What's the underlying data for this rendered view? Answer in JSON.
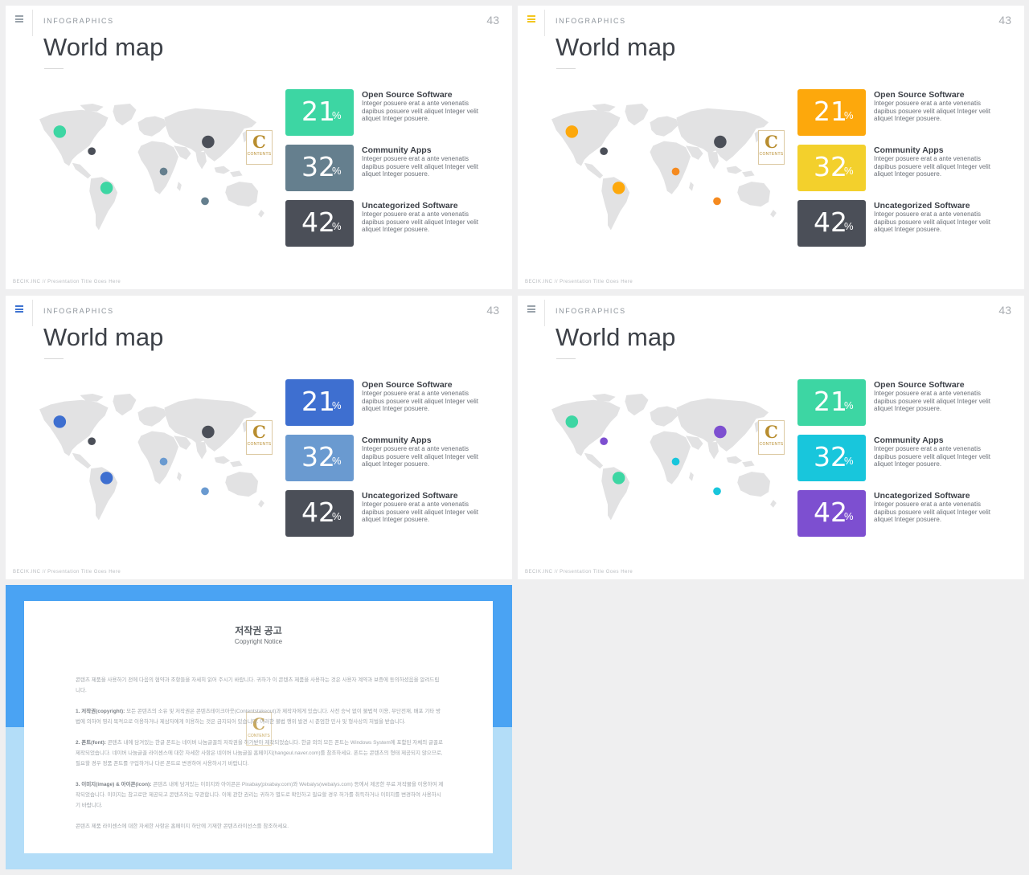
{
  "slides": [
    {
      "tag": "INFOGRAPHICS",
      "title": "World map",
      "page": "43",
      "footer": "BECIK.INC  //  Presentation  Title  Goes  Here",
      "logo": {
        "letter": "C",
        "text": "CONTENTS"
      },
      "accent": "#9aa3ab",
      "dot_colors": [
        "#3dd6a3",
        "#4b4f58",
        "#3dd6a3",
        "#657f8e",
        "#4b4f58",
        "#657f8e"
      ],
      "stats": [
        {
          "value": "21",
          "unit": "%",
          "label": "Open Source Software",
          "desc": "Integer posuere erat a ante venenatis dapibus posuere velit aliquet Integer velit aliquet Integer posuere.",
          "color": "#3dd6a3"
        },
        {
          "value": "32",
          "unit": "%",
          "label": "Community Apps",
          "desc": "Integer posuere erat a ante venenatis dapibus posuere velit aliquet Integer velit aliquet Integer posuere.",
          "color": "#657f8e"
        },
        {
          "value": "42",
          "unit": "%",
          "label": "Uncategorized Software",
          "desc": "Integer posuere erat a ante venenatis dapibus posuere velit aliquet Integer velit aliquet Integer posuere.",
          "color": "#4b4f58"
        }
      ]
    },
    {
      "tag": "INFOGRAPHICS",
      "title": "World map",
      "page": "43",
      "footer": "BECIK.INC  //  Presentation  Title  Goes  Here",
      "logo": {
        "letter": "C",
        "text": "CONTENTS"
      },
      "accent": "#f3c61f",
      "dot_colors": [
        "#fda80c",
        "#4b4f58",
        "#fda80c",
        "#f58a1f",
        "#4b4f58",
        "#f58a1f"
      ],
      "stats": [
        {
          "value": "21",
          "unit": "%",
          "label": "Open Source Software",
          "desc": "Integer posuere erat a ante venenatis dapibus posuere velit aliquet Integer velit aliquet Integer posuere.",
          "color": "#fda80c"
        },
        {
          "value": "32",
          "unit": "%",
          "label": "Community Apps",
          "desc": "Integer posuere erat a ante venenatis dapibus posuere velit aliquet Integer velit aliquet Integer posuere.",
          "color": "#f3d02c"
        },
        {
          "value": "42",
          "unit": "%",
          "label": "Uncategorized Software",
          "desc": "Integer posuere erat a ante venenatis dapibus posuere velit aliquet Integer velit aliquet Integer posuere.",
          "color": "#4b4f58"
        }
      ]
    },
    {
      "tag": "INFOGRAPHICS",
      "title": "World map",
      "page": "43",
      "footer": "BECIK.INC  //  Presentation  Title  Goes  Here",
      "logo": {
        "letter": "C",
        "text": "CONTENTS"
      },
      "accent": "#3e73d1",
      "dot_colors": [
        "#3e6fd0",
        "#4b4f58",
        "#3e6fd0",
        "#6a9ad0",
        "#4b4f58",
        "#6a9ad0"
      ],
      "stats": [
        {
          "value": "21",
          "unit": "%",
          "label": "Open Source Software",
          "desc": "Integer posuere erat a ante venenatis dapibus posuere velit aliquet Integer velit aliquet Integer posuere.",
          "color": "#3e6fd0"
        },
        {
          "value": "32",
          "unit": "%",
          "label": "Community Apps",
          "desc": "Integer posuere erat a ante venenatis dapibus posuere velit aliquet Integer velit aliquet Integer posuere.",
          "color": "#6a9ad0"
        },
        {
          "value": "42",
          "unit": "%",
          "label": "Uncategorized Software",
          "desc": "Integer posuere erat a ante venenatis dapibus posuere velit aliquet Integer velit aliquet Integer posuere.",
          "color": "#4b4f58"
        }
      ]
    },
    {
      "tag": "INFOGRAPHICS",
      "title": "World map",
      "page": "43",
      "footer": "BECIK.INC  //  Presentation  Title  Goes  Here",
      "logo": {
        "letter": "C",
        "text": "CONTENTS"
      },
      "accent": "#9aa3ab",
      "dot_colors": [
        "#3dd6a3",
        "#7d4fd0",
        "#3dd6a3",
        "#18c6dc",
        "#7d4fd0",
        "#18c6dc"
      ],
      "stats": [
        {
          "value": "21",
          "unit": "%",
          "label": "Open Source Software",
          "desc": "Integer posuere erat a ante venenatis dapibus posuere velit aliquet Integer velit aliquet Integer posuere.",
          "color": "#3dd6a3"
        },
        {
          "value": "32",
          "unit": "%",
          "label": "Community Apps",
          "desc": "Integer posuere erat a ante venenatis dapibus posuere velit aliquet Integer velit aliquet Integer posuere.",
          "color": "#18c6dc"
        },
        {
          "value": "42",
          "unit": "%",
          "label": "Uncategorized Software",
          "desc": "Integer posuere erat a ante venenatis dapibus posuere velit aliquet Integer velit aliquet Integer posuere.",
          "color": "#7d4fd0"
        }
      ]
    }
  ],
  "notice": {
    "title": "저작권 공고",
    "subtitle": "Copyright Notice",
    "logo": {
      "letter": "C",
      "text": "CONTENTS"
    },
    "intro": "콘텐츠 제품을 사용하기 전에 다음의 협약과 조항들을 자세히 읽어 주시기 바랍니다. 귀하가 이 콘텐츠 제품을 사용하는 것은 사용자 계약과 보증에 동의하셨음을 알려드립니다.",
    "p1_head": "1. 저작권(copyright):",
    "p1": " 모든 콘텐츠의 소유 및 저작권은 콘텐츠테이크아웃(Contentstakeout)과 제작자에게 있습니다. 사전 승낙 없이 불법적 이용, 무단전재, 배포 기타 방법에 의하여 영리 목적으로 이용하거나 제삼자에게 이용하는 것은 금지되어 있습니다. 이러한 불법 행위 발견 시 준엄한 민사 및 형사상의 처벌을 받습니다.",
    "p2_head": "2. 폰트(font):",
    "p2": " 콘텐츠 내에 담겨있는 한글 폰트는 네이버 나눔글꼴의 저작권을 허가받아 제작되었습니다. 한글 외의 모든 폰트는 Windows System에 포함된 자체의 글꼴로 제작되었습니다. 네이버 나눔글꼴 라이센스에 대한 자세한 사항은 네이버 나눔글꼴 홈페이지(hangeul.naver.com)를 참조하세요. 폰트는 콘텐츠의 형태 제공되지 않으므로, 필요할 경우 정품 폰트를 구입하거나 다른 폰트로 변경하여 사용하시기 바랍니다.",
    "p3_head": "3. 이미지(image) & 아이콘(icon):",
    "p3": " 콘텐츠 내에 담겨있는 이미지와 아이콘은 Pixabay(pixabay.com)와 Webalys(webalys.com) 등에서 제공한 무료 저작물을 이용하여 제작되었습니다. 이미지는 참고로만 제공되고 콘텐츠와는 무관합니다. 이에 관한 권리는 귀하가 별도로 확인하고 필요할 경우 허가를 취득하거나 이미지를 변경하여 사용하시기 바랍니다.",
    "outro": "콘텐츠 제품 라이센스에 대한 자세한 사항은 홈페이지 하단에 기재한 콘텐츠라이선스를 참조하세요."
  }
}
